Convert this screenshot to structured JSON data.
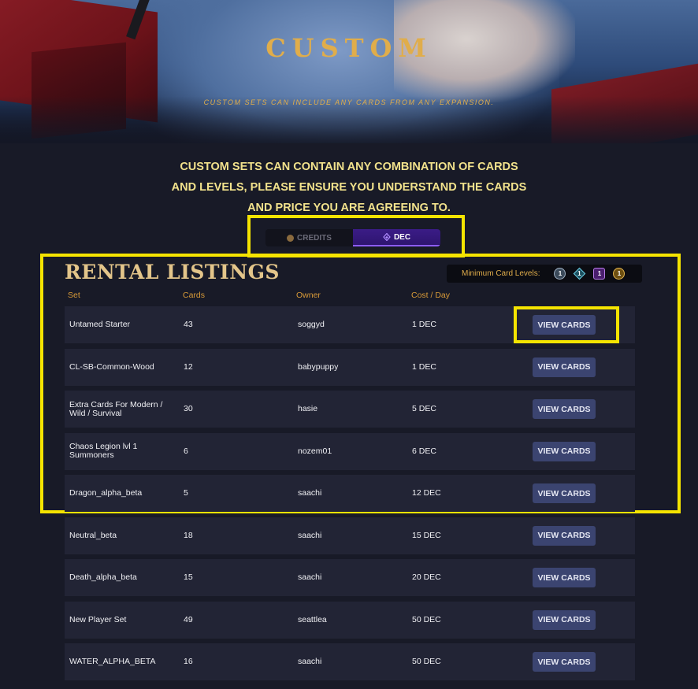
{
  "hero": {
    "title": "CUSTOM",
    "subtitle": "CUSTOM SETS CAN INCLUDE ANY CARDS FROM ANY EXPANSION."
  },
  "notice": {
    "lines": [
      "CUSTOM SETS CAN CONTAIN ANY COMBINATION OF CARDS",
      "AND LEVELS, PLEASE ENSURE YOU UNDERSTAND THE CARDS",
      "AND PRICE YOU ARE AGREEING TO."
    ]
  },
  "currency_toggle": {
    "options": [
      {
        "label": "CREDITS",
        "icon": "credits-coin-icon",
        "active": false
      },
      {
        "label": "DEC",
        "icon": "dec-icon",
        "active": true
      }
    ]
  },
  "listings": {
    "title": "RENTAL LISTINGS",
    "min_levels": {
      "label": "Minimum Card Levels:",
      "levels": [
        {
          "rarity": "common",
          "value": "1",
          "color": "#9fb1c4"
        },
        {
          "rarity": "rare",
          "value": "1",
          "color": "#6fd3ea"
        },
        {
          "rarity": "epic",
          "value": "1",
          "color": "#b77de6"
        },
        {
          "rarity": "legendary",
          "value": "1",
          "color": "#e3b54f"
        }
      ]
    },
    "columns": {
      "set": "Set",
      "cards": "Cards",
      "owner": "Owner",
      "cost": "Cost / Day"
    },
    "button_label": "VIEW CARDS",
    "rows": [
      {
        "set": "Untamed Starter",
        "cards": "43",
        "owner": "soggyd",
        "cost": "1 DEC"
      },
      {
        "set": "CL-SB-Common-Wood",
        "cards": "12",
        "owner": "babypuppy",
        "cost": "1 DEC"
      },
      {
        "set": "Extra Cards For Modern / Wild / Survival",
        "cards": "30",
        "owner": "hasie",
        "cost": "5 DEC"
      },
      {
        "set": "Chaos Legion lvl 1 Summoners",
        "cards": "6",
        "owner": "nozem01",
        "cost": "6 DEC"
      },
      {
        "set": "Dragon_alpha_beta",
        "cards": "5",
        "owner": "saachi",
        "cost": "12 DEC"
      },
      {
        "set": "Neutral_beta",
        "cards": "18",
        "owner": "saachi",
        "cost": "15 DEC"
      },
      {
        "set": "Death_alpha_beta",
        "cards": "15",
        "owner": "saachi",
        "cost": "20 DEC"
      },
      {
        "set": "New Player Set",
        "cards": "49",
        "owner": "seattlea",
        "cost": "50 DEC"
      },
      {
        "set": "WATER_ALPHA_BETA",
        "cards": "16",
        "owner": "saachi",
        "cost": "50 DEC"
      }
    ]
  },
  "colors": {
    "background": "#181a27",
    "gold": "#e0ad4b",
    "notice_yellow": "#f2e28c",
    "row_bg": "#222435",
    "button_bg": "#3b4470",
    "highlight": "#f5e400",
    "dec_purple": "#3b1c86"
  }
}
